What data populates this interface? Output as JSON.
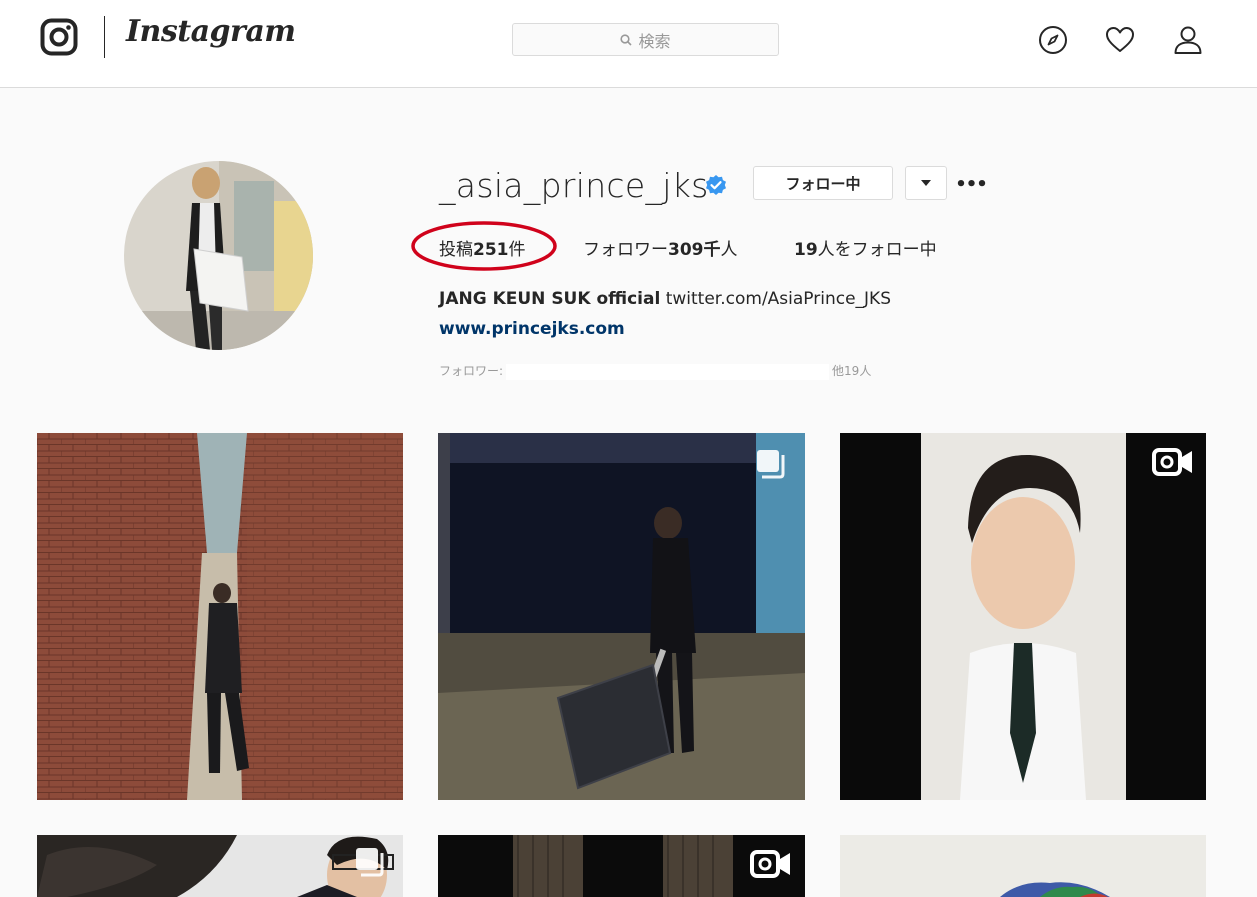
{
  "header": {
    "logo_wordmark": "Instagram",
    "search_placeholder": "検索",
    "icons": [
      "instagram-logo-icon",
      "search-icon",
      "compass-icon",
      "heart-icon",
      "user-icon"
    ]
  },
  "profile": {
    "username": "_asia_prince_jks",
    "verified": true,
    "follow_button": "フォロー中",
    "stats": {
      "posts_label": "投稿",
      "posts_count": "251",
      "posts_suffix": "件",
      "followers_label": "フォロワー",
      "followers_count": "309千",
      "followers_suffix": "人",
      "following_count": "19",
      "following_suffix": "人をフォロー中"
    },
    "bio_name": "JANG KEUN SUK official",
    "bio_text": "twitter.com/AsiaPrince_JKS",
    "website": "www.princejks.com",
    "followed_by_label": "フォロワー:",
    "followed_by_more": "他19人"
  },
  "colors": {
    "background": "#fafafa",
    "topbar": "#ffffff",
    "border": "#dbdbdb",
    "verified": "#3897f0",
    "link": "#003569",
    "annotation": "#d0021b"
  },
  "posts": [
    {
      "name": "post-brick-alley",
      "badge": "none"
    },
    {
      "name": "post-warehouse-suitcase",
      "badge": "multiple-photos-icon"
    },
    {
      "name": "post-video-selfie",
      "badge": "video-icon"
    },
    {
      "name": "post-studio-portrait",
      "badge": "multiple-photos-icon"
    },
    {
      "name": "post-dark-video",
      "badge": "video-icon"
    },
    {
      "name": "post-light-photo",
      "badge": "none"
    }
  ]
}
